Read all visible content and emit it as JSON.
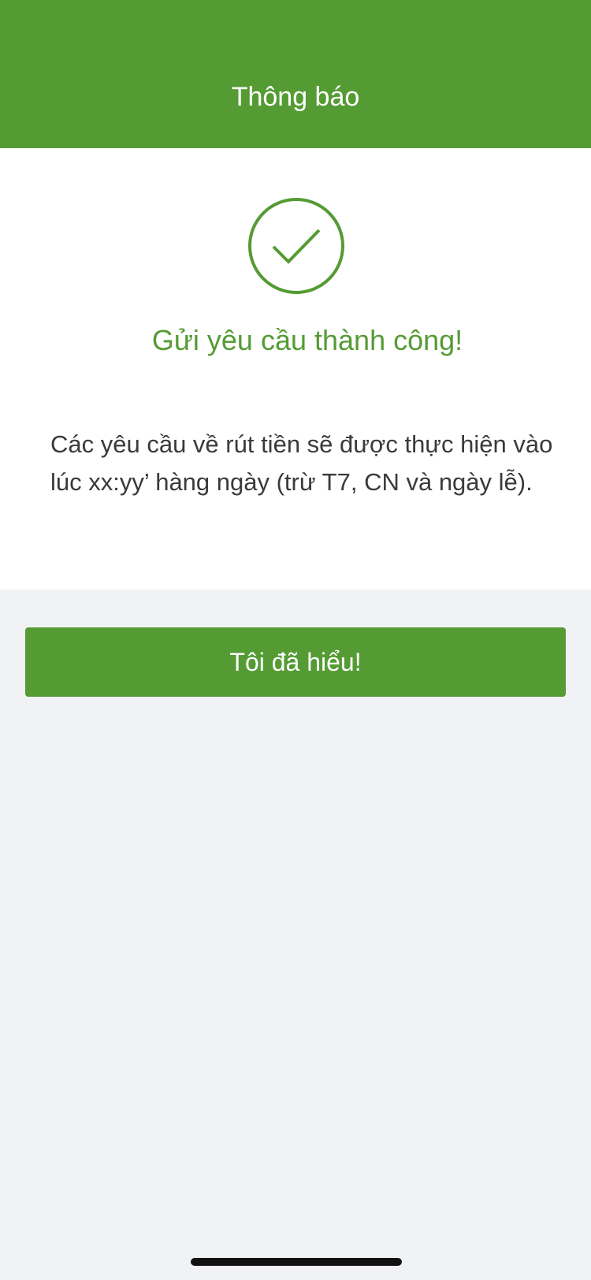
{
  "header": {
    "title": "Thông báo"
  },
  "result": {
    "icon": "check-circle-icon",
    "title": "Gửi yêu cầu thành công!",
    "message": "Các yêu cầu về rút tiền sẽ được thực hiện vào lúc xx:yy’ hàng ngày (trừ T7, CN và ngày lễ)."
  },
  "actions": {
    "confirm_label": "Tôi đã hiểu!"
  },
  "colors": {
    "brand_green": "#559b34",
    "background": "#f1f2f5",
    "text": "#3a3a3a"
  }
}
